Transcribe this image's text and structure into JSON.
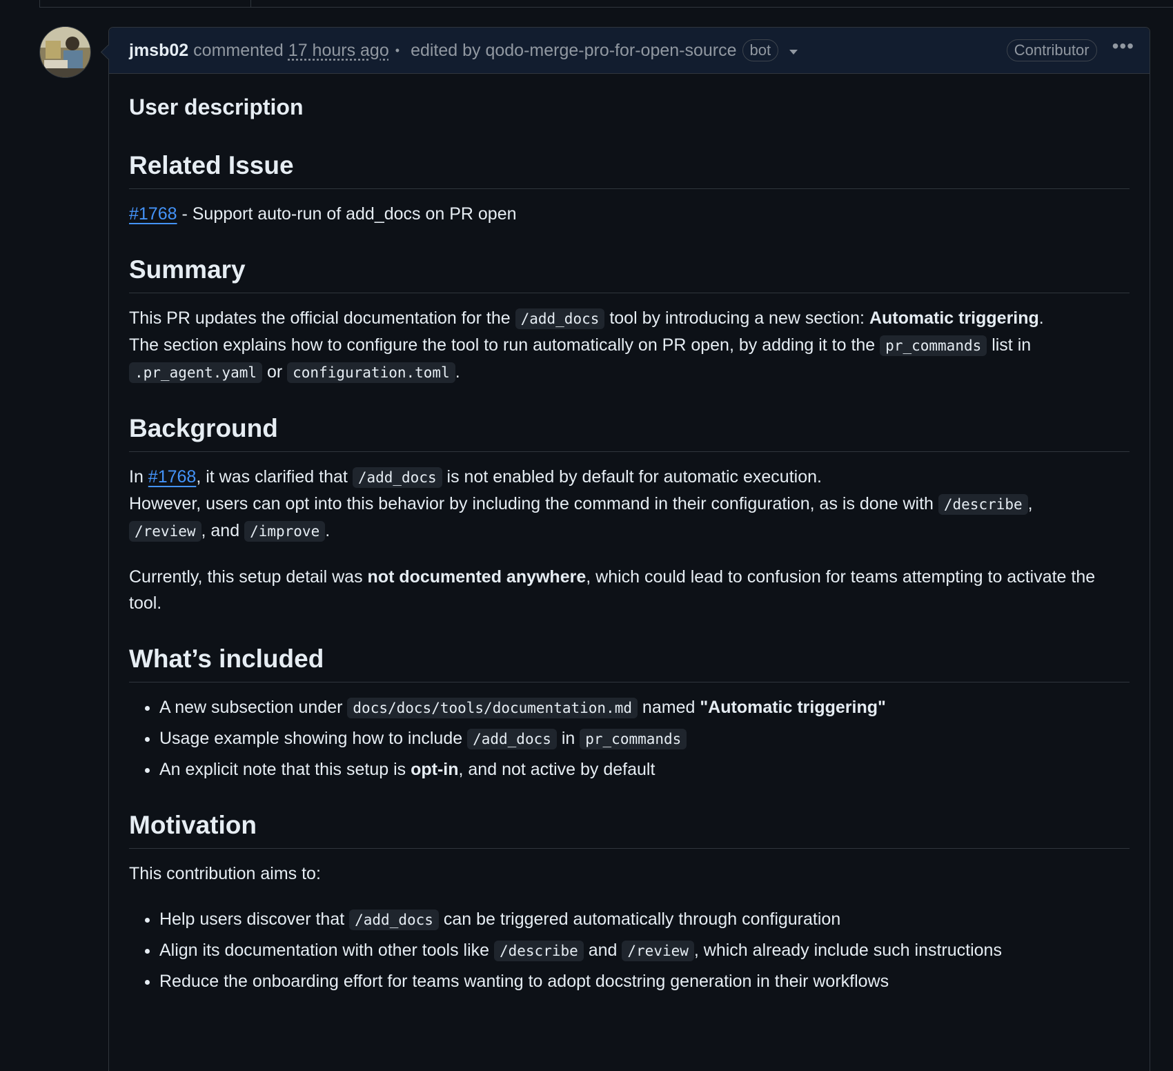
{
  "comment": {
    "author": "jmsb02",
    "action": "commented",
    "timestamp": "17 hours ago",
    "separator": "•",
    "edited_by_label": "edited by qodo-merge-pro-for-open-source",
    "bot_badge": "bot",
    "role_badge": "Contributor",
    "menu_glyph": "•••"
  },
  "body": {
    "user_description": "User description",
    "related_issue": {
      "heading": "Related Issue",
      "issue_link": "#1768",
      "issue_text": " - Support auto-run of add_docs on PR open"
    },
    "summary": {
      "heading": "Summary",
      "p1": "This PR updates the official documentation for the ",
      "c1": "/add_docs",
      "p2": " tool by introducing a new section: ",
      "b1": "Automatic triggering",
      "p3": ".",
      "p4": "The section explains how to configure the tool to run automatically on PR open, by adding it to the ",
      "c2": "pr_commands",
      "p5": " list in ",
      "c3": ".pr_agent.yaml",
      "p6": " or ",
      "c4": "configuration.toml",
      "p7": "."
    },
    "background": {
      "heading": "Background",
      "t1": "In ",
      "link": "#1768",
      "t2": ", it was clarified that ",
      "c1": "/add_docs",
      "t3": " is not enabled by default for automatic execution.",
      "t4": "However, users can opt into this behavior by including the command in their configuration, as is done with ",
      "c2": "/describe",
      "t5": ", ",
      "c3": "/review",
      "t6": ", and ",
      "c4": "/improve",
      "t7": ".",
      "q1": "Currently, this setup detail was ",
      "qb": "not documented anywhere",
      "q2": ", which could lead to confusion for teams attempting to activate the tool."
    },
    "included": {
      "heading": "What’s included",
      "i1a": "A new subsection under ",
      "i1c": "docs/docs/tools/documentation.md",
      "i1b": " named ",
      "i1bold": "\"Automatic triggering\"",
      "i2a": "Usage example showing how to include ",
      "i2c1": "/add_docs",
      "i2b": " in ",
      "i2c2": "pr_commands",
      "i3a": "An explicit note that this setup is ",
      "i3bold": "opt-in",
      "i3b": ", and not active by default"
    },
    "motivation": {
      "heading": "Motivation",
      "intro": "This contribution aims to:",
      "m1a": "Help users discover that ",
      "m1c": "/add_docs",
      "m1b": " can be triggered automatically through configuration",
      "m2a": "Align its documentation with other tools like ",
      "m2c1": "/describe",
      "m2b": " and ",
      "m2c2": "/review",
      "m2d": ", which already include such instructions",
      "m3": "Reduce the onboarding effort for teams wanting to adopt docstring generation in their workflows"
    }
  },
  "colors": {
    "background": "#0d1117",
    "header_bg": "#121d2f",
    "border": "#30363d",
    "link": "#4493f8",
    "text": "#e6edf3",
    "muted": "#9198a1",
    "code_bg": "#1f252d"
  }
}
